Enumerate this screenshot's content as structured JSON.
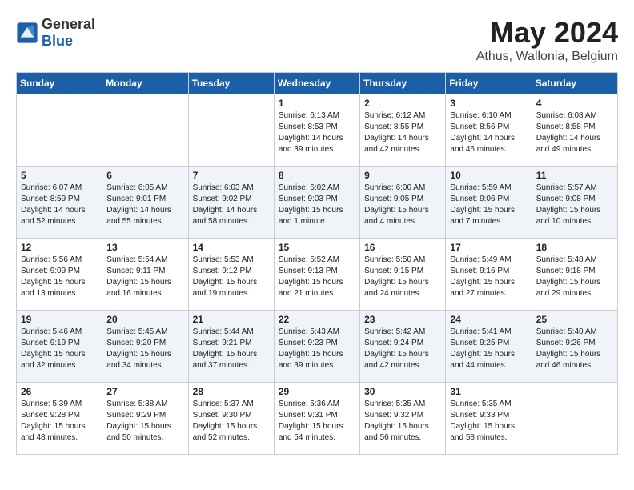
{
  "header": {
    "logo_general": "General",
    "logo_blue": "Blue",
    "month_year": "May 2024",
    "location": "Athus, Wallonia, Belgium"
  },
  "calendar": {
    "weekdays": [
      "Sunday",
      "Monday",
      "Tuesday",
      "Wednesday",
      "Thursday",
      "Friday",
      "Saturday"
    ],
    "weeks": [
      [
        {
          "day": "",
          "info": ""
        },
        {
          "day": "",
          "info": ""
        },
        {
          "day": "",
          "info": ""
        },
        {
          "day": "1",
          "info": "Sunrise: 6:13 AM\nSunset: 8:53 PM\nDaylight: 14 hours\nand 39 minutes."
        },
        {
          "day": "2",
          "info": "Sunrise: 6:12 AM\nSunset: 8:55 PM\nDaylight: 14 hours\nand 42 minutes."
        },
        {
          "day": "3",
          "info": "Sunrise: 6:10 AM\nSunset: 8:56 PM\nDaylight: 14 hours\nand 46 minutes."
        },
        {
          "day": "4",
          "info": "Sunrise: 6:08 AM\nSunset: 8:58 PM\nDaylight: 14 hours\nand 49 minutes."
        }
      ],
      [
        {
          "day": "5",
          "info": "Sunrise: 6:07 AM\nSunset: 8:59 PM\nDaylight: 14 hours\nand 52 minutes."
        },
        {
          "day": "6",
          "info": "Sunrise: 6:05 AM\nSunset: 9:01 PM\nDaylight: 14 hours\nand 55 minutes."
        },
        {
          "day": "7",
          "info": "Sunrise: 6:03 AM\nSunset: 9:02 PM\nDaylight: 14 hours\nand 58 minutes."
        },
        {
          "day": "8",
          "info": "Sunrise: 6:02 AM\nSunset: 9:03 PM\nDaylight: 15 hours\nand 1 minute."
        },
        {
          "day": "9",
          "info": "Sunrise: 6:00 AM\nSunset: 9:05 PM\nDaylight: 15 hours\nand 4 minutes."
        },
        {
          "day": "10",
          "info": "Sunrise: 5:59 AM\nSunset: 9:06 PM\nDaylight: 15 hours\nand 7 minutes."
        },
        {
          "day": "11",
          "info": "Sunrise: 5:57 AM\nSunset: 9:08 PM\nDaylight: 15 hours\nand 10 minutes."
        }
      ],
      [
        {
          "day": "12",
          "info": "Sunrise: 5:56 AM\nSunset: 9:09 PM\nDaylight: 15 hours\nand 13 minutes."
        },
        {
          "day": "13",
          "info": "Sunrise: 5:54 AM\nSunset: 9:11 PM\nDaylight: 15 hours\nand 16 minutes."
        },
        {
          "day": "14",
          "info": "Sunrise: 5:53 AM\nSunset: 9:12 PM\nDaylight: 15 hours\nand 19 minutes."
        },
        {
          "day": "15",
          "info": "Sunrise: 5:52 AM\nSunset: 9:13 PM\nDaylight: 15 hours\nand 21 minutes."
        },
        {
          "day": "16",
          "info": "Sunrise: 5:50 AM\nSunset: 9:15 PM\nDaylight: 15 hours\nand 24 minutes."
        },
        {
          "day": "17",
          "info": "Sunrise: 5:49 AM\nSunset: 9:16 PM\nDaylight: 15 hours\nand 27 minutes."
        },
        {
          "day": "18",
          "info": "Sunrise: 5:48 AM\nSunset: 9:18 PM\nDaylight: 15 hours\nand 29 minutes."
        }
      ],
      [
        {
          "day": "19",
          "info": "Sunrise: 5:46 AM\nSunset: 9:19 PM\nDaylight: 15 hours\nand 32 minutes."
        },
        {
          "day": "20",
          "info": "Sunrise: 5:45 AM\nSunset: 9:20 PM\nDaylight: 15 hours\nand 34 minutes."
        },
        {
          "day": "21",
          "info": "Sunrise: 5:44 AM\nSunset: 9:21 PM\nDaylight: 15 hours\nand 37 minutes."
        },
        {
          "day": "22",
          "info": "Sunrise: 5:43 AM\nSunset: 9:23 PM\nDaylight: 15 hours\nand 39 minutes."
        },
        {
          "day": "23",
          "info": "Sunrise: 5:42 AM\nSunset: 9:24 PM\nDaylight: 15 hours\nand 42 minutes."
        },
        {
          "day": "24",
          "info": "Sunrise: 5:41 AM\nSunset: 9:25 PM\nDaylight: 15 hours\nand 44 minutes."
        },
        {
          "day": "25",
          "info": "Sunrise: 5:40 AM\nSunset: 9:26 PM\nDaylight: 15 hours\nand 46 minutes."
        }
      ],
      [
        {
          "day": "26",
          "info": "Sunrise: 5:39 AM\nSunset: 9:28 PM\nDaylight: 15 hours\nand 48 minutes."
        },
        {
          "day": "27",
          "info": "Sunrise: 5:38 AM\nSunset: 9:29 PM\nDaylight: 15 hours\nand 50 minutes."
        },
        {
          "day": "28",
          "info": "Sunrise: 5:37 AM\nSunset: 9:30 PM\nDaylight: 15 hours\nand 52 minutes."
        },
        {
          "day": "29",
          "info": "Sunrise: 5:36 AM\nSunset: 9:31 PM\nDaylight: 15 hours\nand 54 minutes."
        },
        {
          "day": "30",
          "info": "Sunrise: 5:35 AM\nSunset: 9:32 PM\nDaylight: 15 hours\nand 56 minutes."
        },
        {
          "day": "31",
          "info": "Sunrise: 5:35 AM\nSunset: 9:33 PM\nDaylight: 15 hours\nand 58 minutes."
        },
        {
          "day": "",
          "info": ""
        }
      ]
    ]
  }
}
